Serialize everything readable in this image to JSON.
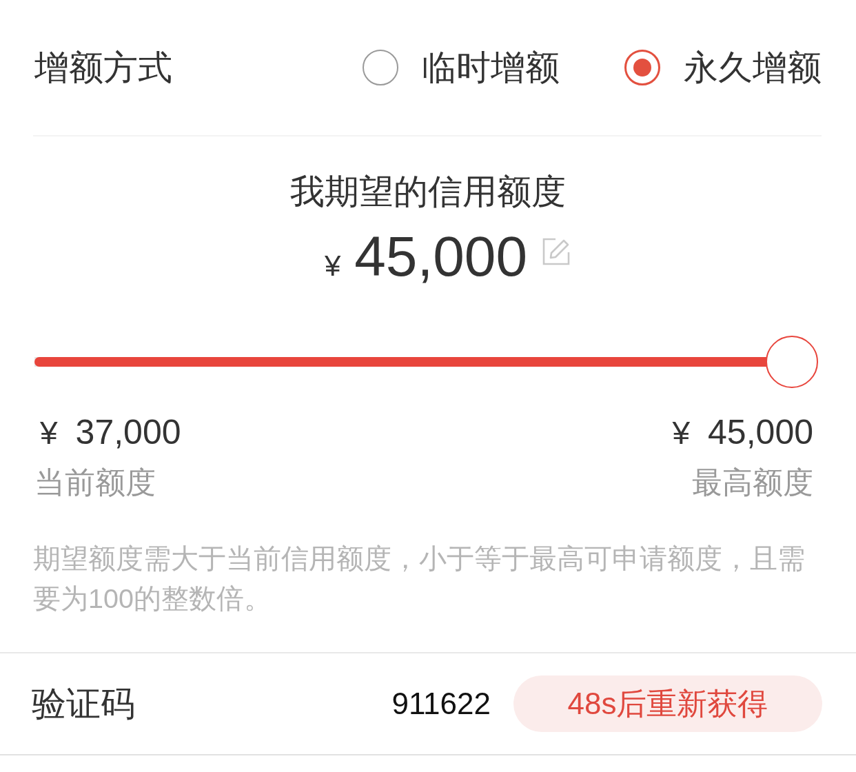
{
  "increase_mode": {
    "label": "增额方式",
    "options": [
      {
        "label": "临时增额",
        "selected": false
      },
      {
        "label": "永久增额",
        "selected": true
      }
    ]
  },
  "expected_limit": {
    "title": "我期望的信用额度",
    "currency": "¥",
    "amount": "45,000"
  },
  "slider": {
    "level": 1.0,
    "min": {
      "currency": "¥",
      "amount": "37,000",
      "caption": "当前额度"
    },
    "max": {
      "currency": "¥",
      "amount": "45,000",
      "caption": "最高额度"
    }
  },
  "hint": "期望额度需大于当前信用额度，小于等于最高可申请额度，且需要为100的整数倍。",
  "verification": {
    "label": "验证码",
    "value": "911622",
    "resend_button": "48s后重新获得"
  }
}
